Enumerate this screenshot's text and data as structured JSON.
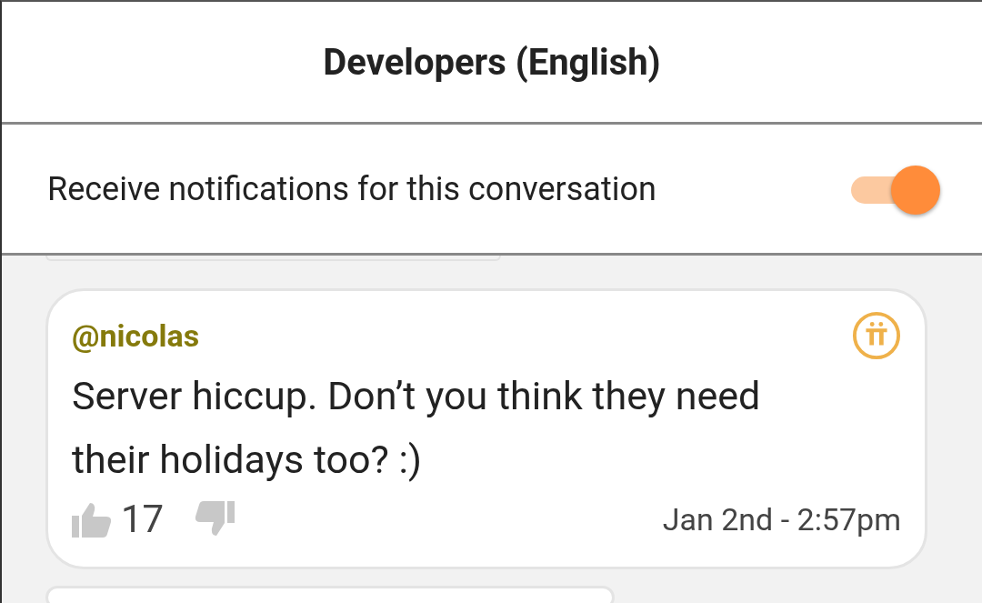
{
  "header": {
    "title": "Developers (English)"
  },
  "notifications": {
    "label": "Receive notifications for this conversation",
    "on": true
  },
  "messages": [
    {
      "author": "@nicolas",
      "text": "Server hiccup. Don’t you think they need their holidays too? :)",
      "likes": "17",
      "timestamp": "Jan 2nd - 2:57pm"
    }
  ]
}
